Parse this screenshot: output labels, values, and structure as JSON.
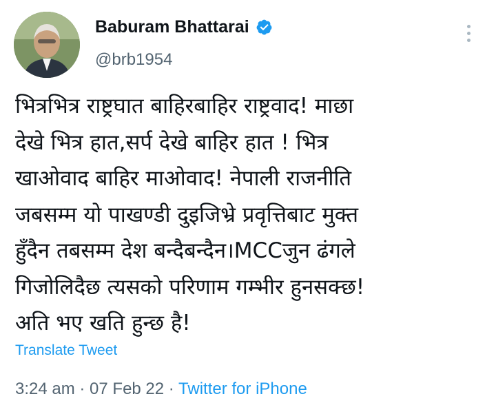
{
  "user": {
    "display_name": "Baburam Bhattarai",
    "handle": "@brb1954",
    "verified_color": "#1d9bf0"
  },
  "tweet": {
    "lines": [
      "भित्रभित्र  राष्ट्रघात बाहिरबाहिर राष्ट्रवाद! माछा",
      "देखे भित्र हात,सर्प देखे बाहिर हात ! भित्र",
      "खाओवाद बाहिर माओवाद! नेपाली राजनीति",
      "जबसम्म यो पाखण्डी दुइजिभ्रे प्रवृत्तिबाट मुक्त",
      "हुँदैन तबसम्म देश बन्दैबन्दैन।MCCजुन ढंगले",
      "गिजोलिदैछ त्यसको परिणाम गम्भीर हुनसक्छ!",
      "अति भए खति हुन्छ है!"
    ],
    "translate_label": "Translate Tweet"
  },
  "meta": {
    "time": "3:24 am",
    "separator": " · ",
    "date": "07 Feb 22",
    "source": "Twitter for iPhone"
  },
  "icons": {
    "verified": "verified-badge-icon",
    "more": "more-options-icon"
  }
}
